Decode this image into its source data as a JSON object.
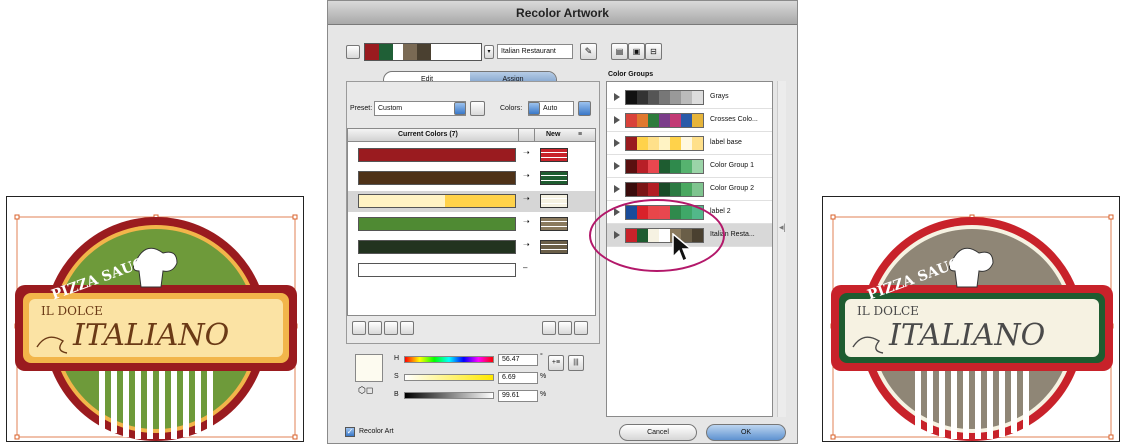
{
  "dialog": {
    "title": "Recolor Artwork",
    "preset_name": "Italian Restaurant",
    "header_swatches": [
      "#9a1b1f",
      "#1f5f36",
      "#ffffff",
      "#7a6a54",
      "#4a4030"
    ],
    "tabs": [
      {
        "label": "Edit"
      },
      {
        "label": "Assign"
      }
    ],
    "preset_label": "Preset:",
    "preset_value": "Custom",
    "colors_label": "Colors:",
    "colors_value": "Auto",
    "current_colors_header": "Current Colors (7)",
    "new_header": "New",
    "rows": [
      {
        "current": "#9a1b1f",
        "new": "#c8222a"
      },
      {
        "current": "#4e3218",
        "new": "#1e5c30"
      },
      {
        "current": "#ffe08a",
        "new": "#f6f2e2"
      },
      {
        "current": "#4f8a33",
        "new": "#8a7a5e"
      },
      {
        "current": "#22331f",
        "new": "#6a5e48"
      }
    ],
    "hsb": {
      "h_label": "H",
      "h_value": "56.47",
      "s_label": "S",
      "s_value": "6.69",
      "b_label": "B",
      "b_value": "99.61",
      "deg": "°",
      "pct": "%"
    },
    "recolor_art_label": "Recolor Art",
    "recolor_art_checked": true,
    "cancel_label": "Cancel",
    "ok_label": "OK",
    "color_groups_title": "Color Groups",
    "groups": [
      {
        "name": "Grays",
        "colors": [
          "#111111",
          "#333333",
          "#555555",
          "#777777",
          "#999999",
          "#bbbbbb",
          "#dddddd"
        ]
      },
      {
        "name": "Crosses Colo...",
        "colors": [
          "#d9423a",
          "#e0782e",
          "#2e7b3c",
          "#7b3c8a",
          "#c23a75",
          "#2a5aa8",
          "#e6b43a"
        ]
      },
      {
        "name": "label base",
        "colors": [
          "#9a1b1f",
          "#ffd24a",
          "#ffe08a",
          "#fff3c4",
          "#ffd24a",
          "#fff8e0",
          "#ffe08a"
        ]
      },
      {
        "name": "Color Group 1",
        "colors": [
          "#5a1010",
          "#b81f27",
          "#e8474f",
          "#1e5c30",
          "#2f8a4c",
          "#56b36f",
          "#9bd4a8"
        ]
      },
      {
        "name": "Color Group 2",
        "colors": [
          "#3a0c0c",
          "#7a1515",
          "#b21e24",
          "#1a4a28",
          "#2b7a42",
          "#4aa860",
          "#7fc48f"
        ]
      },
      {
        "name": "label 2",
        "colors": [
          "#1a4c9a",
          "#d9222a",
          "#e8464a",
          "#e8474f",
          "#2f8a4c",
          "#3fa868",
          "#52b88a"
        ]
      },
      {
        "name": "Italian Resta...",
        "colors": [
          "#c8222a",
          "#1e5c30",
          "#f6f2e2",
          "#ffffff",
          "#8a7a5e",
          "#6a5e48",
          "#4a4030"
        ]
      }
    ]
  },
  "art_left": {
    "top_text": "PIZZA SAUCE",
    "sub_text": "IL DOLCE",
    "main_text": "ITALIANO",
    "outer": "#9a1b1f",
    "field": "#6e9a3a",
    "label_bg": "#fbe3a4",
    "trim": "#f2b54a",
    "stripe": "#ffffff"
  },
  "art_right": {
    "top_text": "PIZZA SAUCE",
    "sub_text": "IL DOLCE",
    "main_text": "ITALIANO",
    "outer": "#c8222a",
    "field": "#8f8676",
    "label_bg": "#f6f2e2",
    "trim": "#1e5c30",
    "stripe": "#ffffff"
  }
}
